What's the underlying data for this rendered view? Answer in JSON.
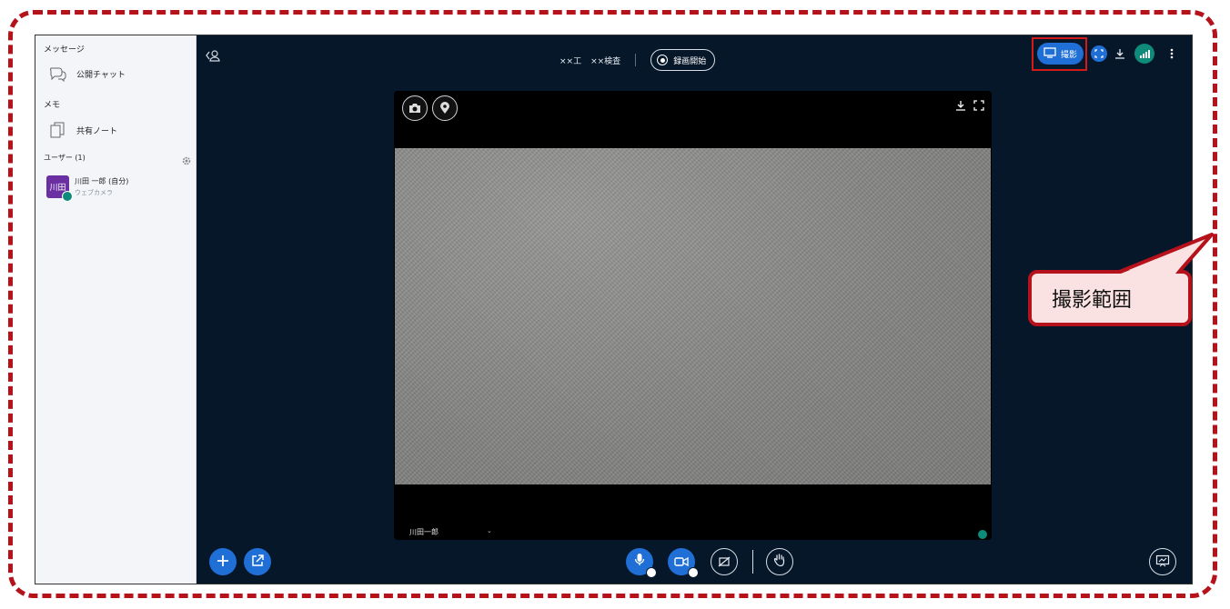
{
  "sidebar": {
    "messages_title": "メッセージ",
    "public_chat": "公開チャット",
    "memo_title": "メモ",
    "shared_note": "共有ノート",
    "users_title": "ユーザー (1)",
    "user": {
      "avatar_text": "川田",
      "name": "川田 一郎 (自分)",
      "sub": "ウェブカメラ"
    }
  },
  "topbar": {
    "title_left": "××工",
    "title_right": "××検査",
    "record_label": "録画開始",
    "shoot_label": "撮影"
  },
  "video": {
    "participant_name": "川田一郎"
  },
  "callout": {
    "text": "撮影範囲"
  },
  "colors": {
    "accent": "#1f6fd6",
    "annotation": "#b5121b",
    "background": "#06172a",
    "status": "#0f8b7c"
  },
  "icons": [
    "user-list-toggle-icon",
    "monitor-icon",
    "fullscreen-icon",
    "download-icon",
    "connection-signal-icon",
    "more-vertical-icon",
    "camera-icon",
    "location-pin-icon",
    "chat-icon",
    "note-icon",
    "gear-icon",
    "plus-icon",
    "external-link-icon",
    "microphone-icon",
    "video-camera-icon",
    "screen-share-off-icon",
    "raise-hand-icon",
    "presentation-icon"
  ]
}
